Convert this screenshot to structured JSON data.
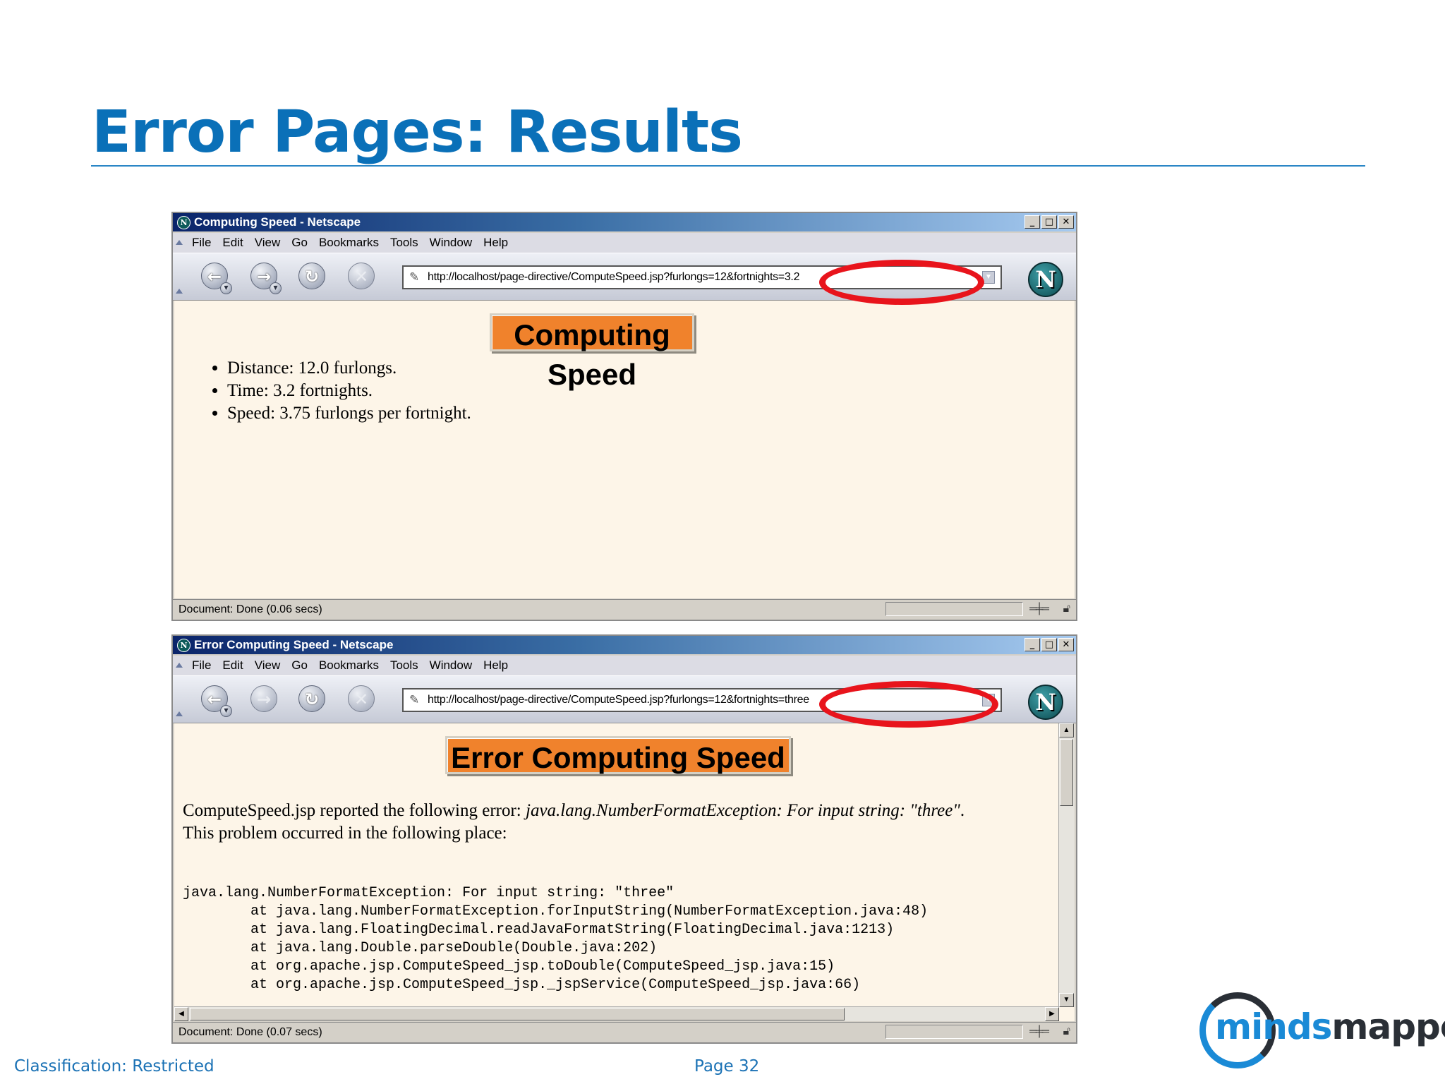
{
  "slide": {
    "title": "Error Pages: Results",
    "footer_left": "Classification: Restricted",
    "footer_center": "Page 32",
    "logo_text_part1": "minds",
    "logo_text_part2": "mapped"
  },
  "menu_items": [
    "File",
    "Edit",
    "View",
    "Go",
    "Bookmarks",
    "Tools",
    "Window",
    "Help"
  ],
  "window1": {
    "title": "Computing Speed - Netscape",
    "url": "http://localhost/page-directive/ComputeSpeed.jsp?furlongs=12&fortnights=3.2",
    "heading": "Computing Speed",
    "results": [
      "Distance: 12.0 furlongs.",
      "Time: 3.2 fortnights.",
      "Speed: 3.75 furlongs per fortnight."
    ],
    "status": "Document: Done (0.06 secs)"
  },
  "window2": {
    "title": "Error Computing Speed - Netscape",
    "url": "http://localhost/page-directive/ComputeSpeed.jsp?furlongs=12&fortnights=three",
    "heading": "Error Computing Speed",
    "error_intro": "ComputeSpeed.jsp reported the following error: ",
    "error_exception": "java.lang.NumberFormatException: For input string: \"three\"",
    "error_suffix": ".",
    "error_line2": "This problem occurred in the following place:",
    "stack_trace": [
      "java.lang.NumberFormatException: For input string: \"three\"",
      "        at java.lang.NumberFormatException.forInputString(NumberFormatException.java:48)",
      "        at java.lang.FloatingDecimal.readJavaFormatString(FloatingDecimal.java:1213)",
      "        at java.lang.Double.parseDouble(Double.java:202)",
      "        at org.apache.jsp.ComputeSpeed_jsp.toDouble(ComputeSpeed_jsp.java:15)",
      "        at org.apache.jsp.ComputeSpeed_jsp._jspService(ComputeSpeed_jsp.java:66)"
    ],
    "status": "Document: Done (0.07 secs)"
  },
  "icons": {
    "back": "left-arrow",
    "forward": "right-arrow",
    "reload": "reload",
    "stop": "stop-x",
    "brand": "netscape-n-logo"
  },
  "colors": {
    "title_blue": "#0a70b8",
    "heading_orange": "#f0822c",
    "page_bg": "#fdf5e8",
    "highlight_red": "#e8141c",
    "footer_blue": "#1b72b5"
  }
}
